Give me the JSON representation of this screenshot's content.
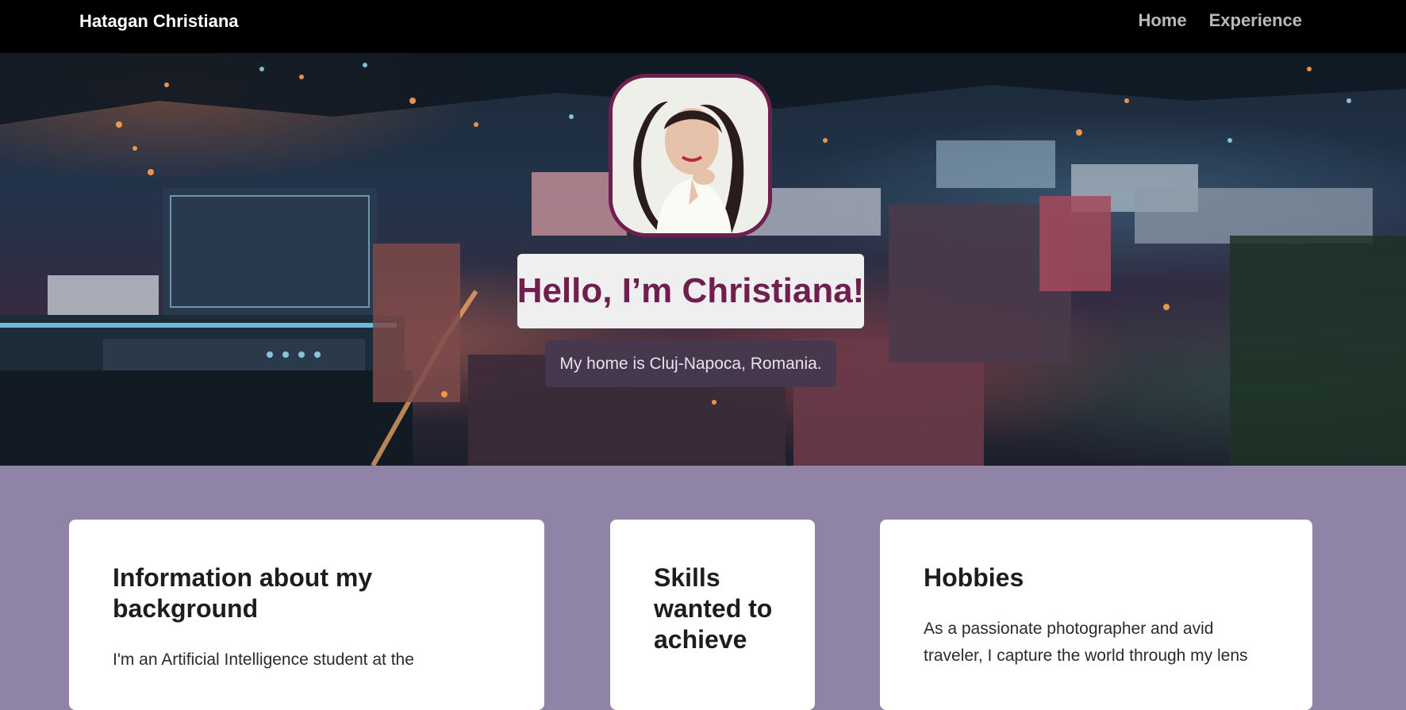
{
  "navbar": {
    "brand": "Hatagan Christiana",
    "links": [
      "Home",
      "Experience"
    ]
  },
  "hero": {
    "title": "Hello, I’m Christiana!",
    "subtitle": "My home is Cluj-Napoca, Romania."
  },
  "cards": {
    "background": {
      "title": "Information about my background",
      "text": "I'm an Artificial Intelligence student at the"
    },
    "skills": {
      "title": "Skills wanted to achieve"
    },
    "hobbies": {
      "title": "Hobbies",
      "text": "As a passionate photographer and avid traveler, I capture the world through my lens"
    }
  },
  "colors": {
    "accent": "#6e1f4d",
    "page_background": "#8f83a6",
    "navbar": "#000000"
  }
}
